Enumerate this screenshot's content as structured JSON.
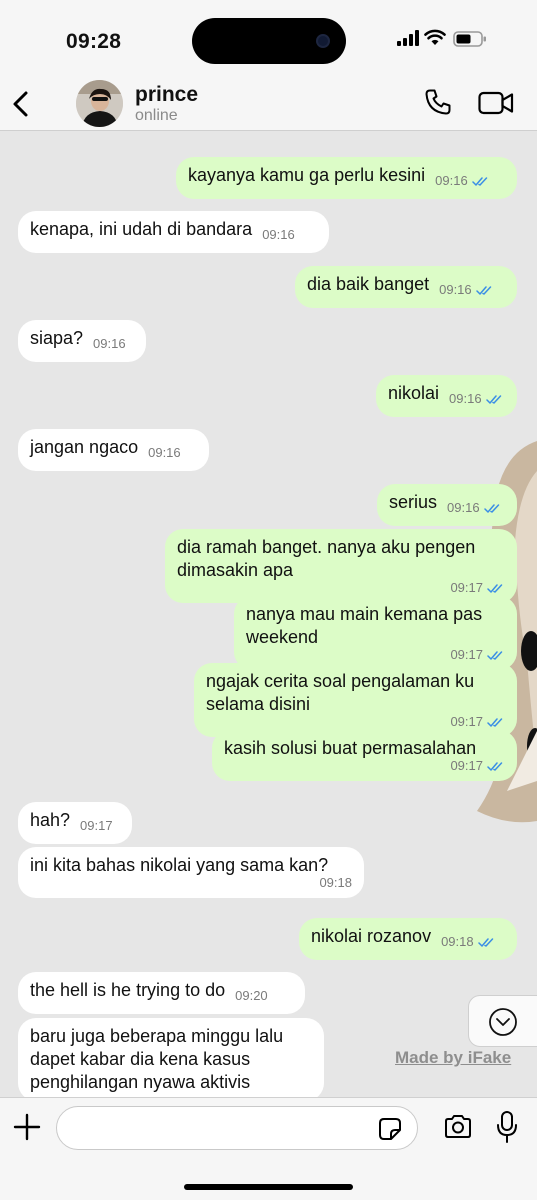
{
  "status_bar": {
    "time": "09:28"
  },
  "header": {
    "name": "prince",
    "status": "online"
  },
  "messages": [
    {
      "dir": "out",
      "text": "kayanya kamu ga perlu kesini",
      "time": "09:16"
    },
    {
      "dir": "in",
      "text": "kenapa, ini udah di bandara",
      "time": "09:16"
    },
    {
      "dir": "out",
      "text": "dia baik banget",
      "time": "09:16"
    },
    {
      "dir": "in",
      "text": "siapa?",
      "time": "09:16"
    },
    {
      "dir": "out",
      "text": "nikolai",
      "time": "09:16"
    },
    {
      "dir": "in",
      "text": "jangan ngaco",
      "time": "09:16"
    },
    {
      "dir": "out",
      "text": "serius",
      "time": "09:16"
    },
    {
      "dir": "out",
      "text": "dia ramah banget. nanya aku pengen dimasakin apa",
      "time": "09:17"
    },
    {
      "dir": "out",
      "text": "nanya mau main kemana pas weekend",
      "time": "09:17"
    },
    {
      "dir": "out",
      "text": "ngajak cerita soal pengalaman ku selama disini",
      "time": "09:17"
    },
    {
      "dir": "out",
      "text": "kasih solusi buat permasalahan",
      "time": "09:17"
    },
    {
      "dir": "in",
      "text": "hah?",
      "time": "09:17"
    },
    {
      "dir": "in",
      "text": "ini kita bahas nikolai yang sama kan?",
      "time": "09:18"
    },
    {
      "dir": "out",
      "text": "nikolai rozanov",
      "time": "09:18"
    },
    {
      "dir": "in",
      "text": "the hell is he trying to do",
      "time": "09:20"
    },
    {
      "dir": "in",
      "text": "baru juga beberapa minggu lalu dapet kabar dia kena kasus penghilangan nyawa aktivis",
      "time": ""
    }
  ],
  "watermark": "Made by iFake",
  "input": {
    "placeholder": ""
  },
  "colors": {
    "outgoing_bubble": "#dcfcc7",
    "incoming_bubble": "#ffffff",
    "read_tick": "#3a8ee6",
    "chat_background": "#e6e6e6"
  }
}
